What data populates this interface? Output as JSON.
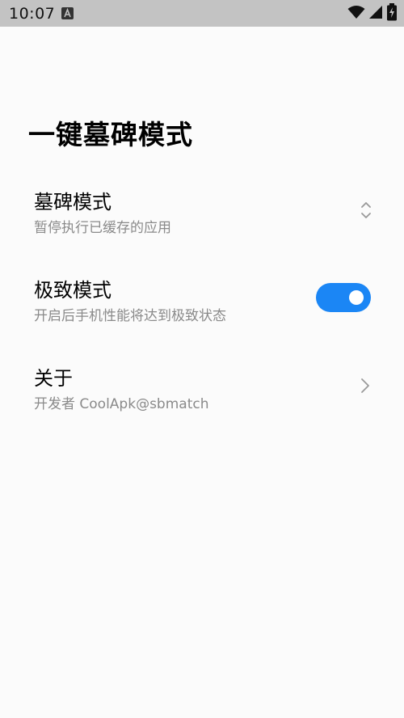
{
  "status_bar": {
    "time": "10:07",
    "notification_icon": "a-notification-icon",
    "icons": [
      "wifi-icon",
      "cellular-signal-icon",
      "battery-charging-icon"
    ]
  },
  "page": {
    "title": "一键墓碑模式"
  },
  "settings": [
    {
      "title": "墓碑模式",
      "subtitle": "暂停执行已缓存的应用",
      "control": "dropdown-updown-icon"
    },
    {
      "title": "极致模式",
      "subtitle": "开启后手机性能将达到极致状态",
      "control": "toggle",
      "enabled": true
    },
    {
      "title": "关于",
      "subtitle": "开发者 CoolApk@sbmatch",
      "control": "chevron-right-icon"
    }
  ],
  "colors": {
    "status_bar_bg": "#c3c3c3",
    "page_bg": "#fbfbfb",
    "accent": "#1b86f5",
    "subtitle": "#8a8a8a"
  }
}
